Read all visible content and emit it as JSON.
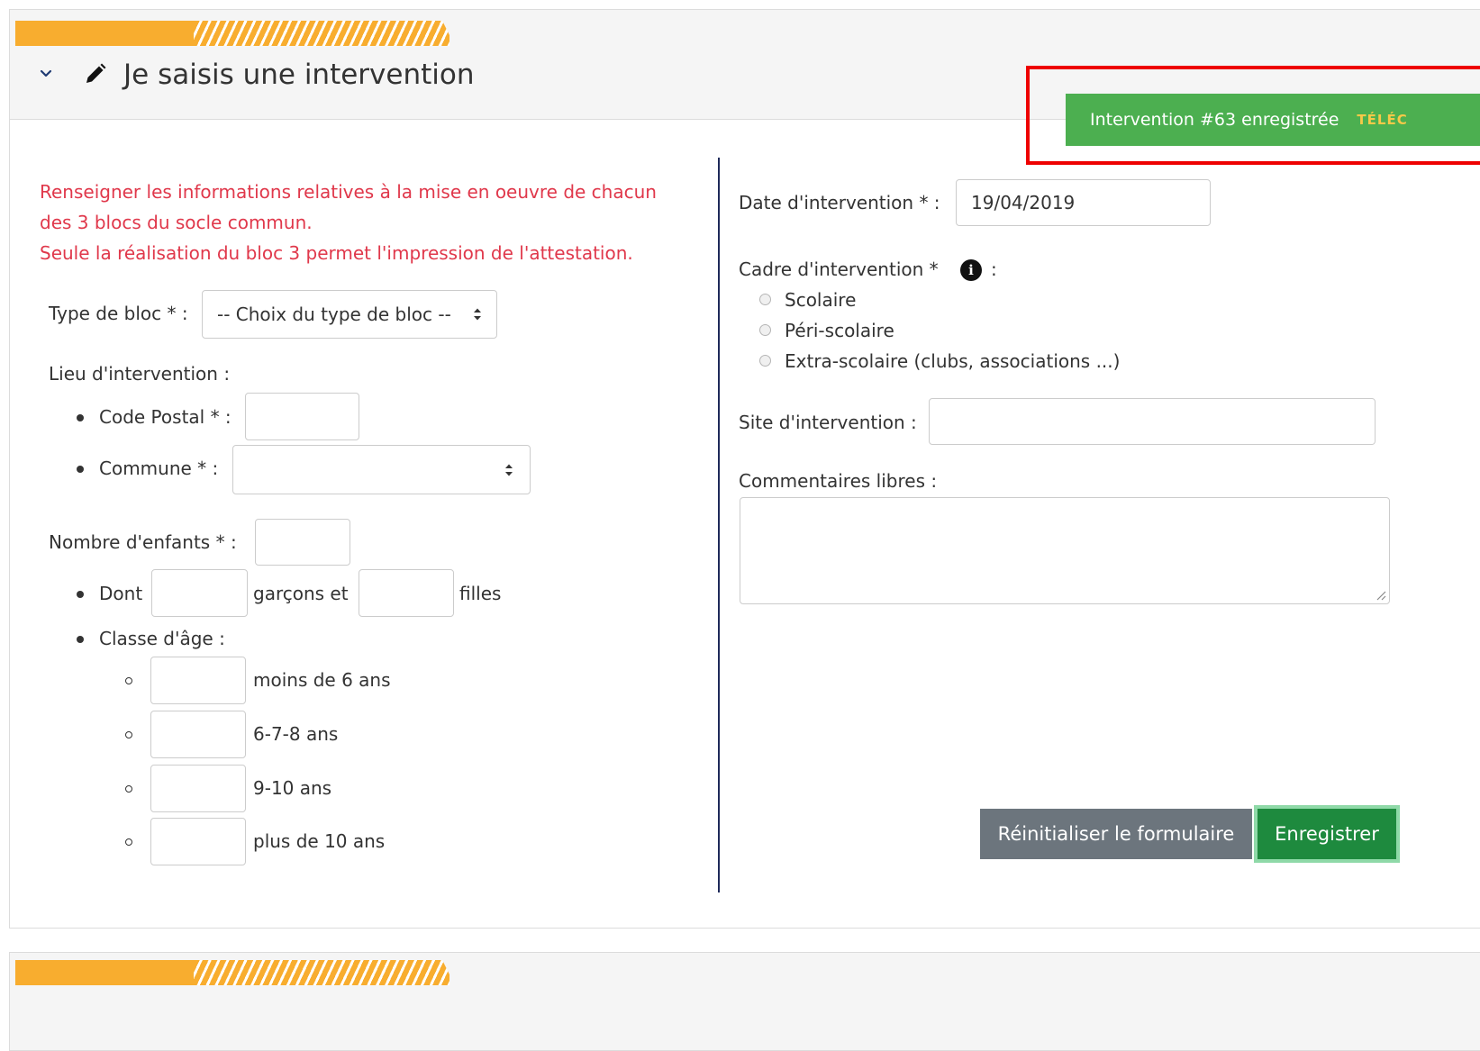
{
  "panel": {
    "title": "Je saisis une intervention",
    "collapse_icon": "chevron-down-icon",
    "title_icon": "pencil-icon"
  },
  "notice": {
    "line1": "Renseigner les informations relatives à la mise en oeuvre de chacun",
    "line2": "des 3 blocs du socle commun.",
    "line3": "Seule la réalisation du bloc 3 permet l'impression de l'attestation."
  },
  "form_left": {
    "type_bloc_label": "Type de bloc * :",
    "type_bloc_selected": "-- Choix du type de bloc --",
    "lieu_label": "Lieu d'intervention :",
    "code_postal_label": "Code Postal * :",
    "code_postal_value": "",
    "commune_label": "Commune * :",
    "commune_selected": "",
    "nb_enfants_label": "Nombre d'enfants * :",
    "nb_enfants_value": "",
    "dont_label": "Dont",
    "garcons_label": "garçons et",
    "filles_label": "filles",
    "classe_age_label": "Classe d'âge :",
    "age_classes": [
      "moins de 6 ans",
      "6-7-8 ans",
      "9-10 ans",
      "plus de 10 ans"
    ]
  },
  "form_right": {
    "date_label": "Date d'intervention * :",
    "date_value": "19/04/2019",
    "cadre_label": "Cadre d'intervention *",
    "cadre_colon": ":",
    "cadre_options": [
      "Scolaire",
      "Péri-scolaire",
      "Extra-scolaire (clubs, associations ...)"
    ],
    "info_icon": "info-circle-icon",
    "site_label": "Site d'intervention :",
    "site_value": "",
    "commentaires_label": "Commentaires libres :",
    "commentaires_value": ""
  },
  "buttons": {
    "reset_label": "Réinitialiser le formulaire",
    "save_label": "Enregistrer"
  },
  "toast": {
    "message": "Intervention #63 enregistrée",
    "action": "TÉLÉC",
    "highlight_color": "#ee0000",
    "background": "#4caf50"
  },
  "colors": {
    "accent_stripe": "#f8ad2f",
    "notice_text": "#e0384b",
    "divider": "#1f2a5a",
    "save_button": "#1e8a3e",
    "reset_button": "#6c757d"
  }
}
